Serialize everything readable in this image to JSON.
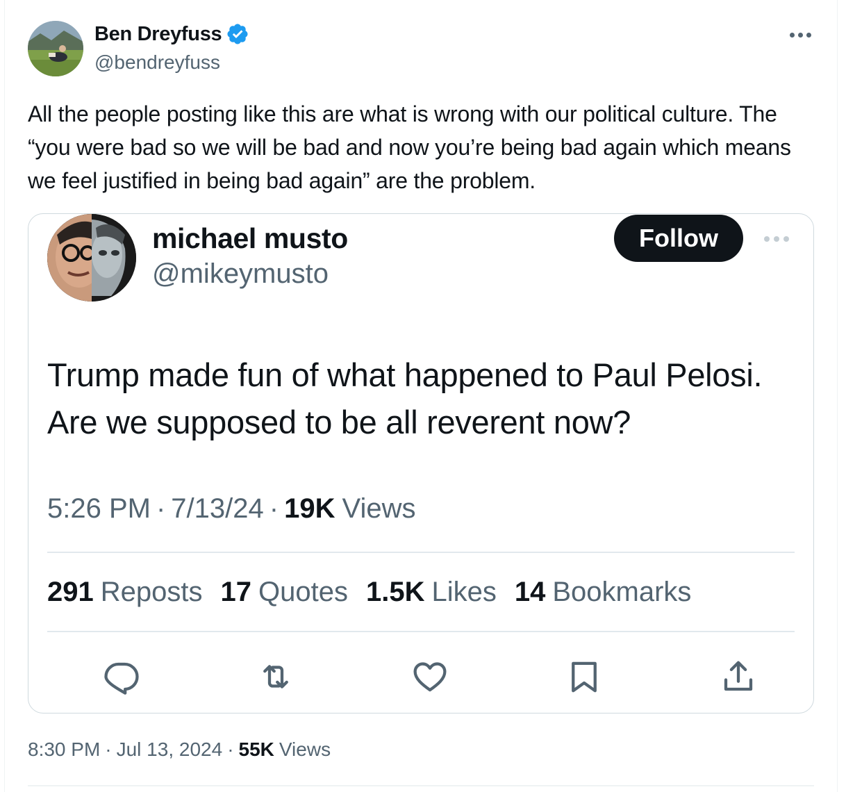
{
  "tweet": {
    "author": {
      "display_name": "Ben Dreyfuss",
      "handle": "@bendreyfuss",
      "verified": true,
      "verified_color": "#1d9bf0"
    },
    "text": "All the people posting like this are what is wrong with our political culture. The “you were bad so we will be bad and now you’re being bad again which means we feel justified in being bad again” are the problem.",
    "time": "8:30 PM",
    "date": "Jul 13, 2024",
    "views_count": "55K",
    "views_label": "Views",
    "separator": "·"
  },
  "quoted_tweet": {
    "author": {
      "display_name": "michael musto",
      "handle": "@mikeymusto"
    },
    "follow_label": "Follow",
    "text": "Trump made fun of what happened to Paul Pelosi. Are we supposed to be all reverent now?",
    "time": "5:26 PM",
    "date": "7/13/24",
    "views_count": "19K",
    "views_label": "Views",
    "separator": "·",
    "stats": {
      "reposts": {
        "count": "291",
        "label": "Reposts"
      },
      "quotes": {
        "count": "17",
        "label": "Quotes"
      },
      "likes": {
        "count": "1.5K",
        "label": "Likes"
      },
      "bookmarks": {
        "count": "14",
        "label": "Bookmarks"
      }
    },
    "actions": [
      "reply-icon",
      "repost-icon",
      "like-icon",
      "bookmark-icon",
      "share-icon"
    ]
  },
  "colors": {
    "text_primary": "#0f1419",
    "text_secondary": "#536471",
    "border": "#cfd9de",
    "follow_bg": "#0f1419"
  }
}
